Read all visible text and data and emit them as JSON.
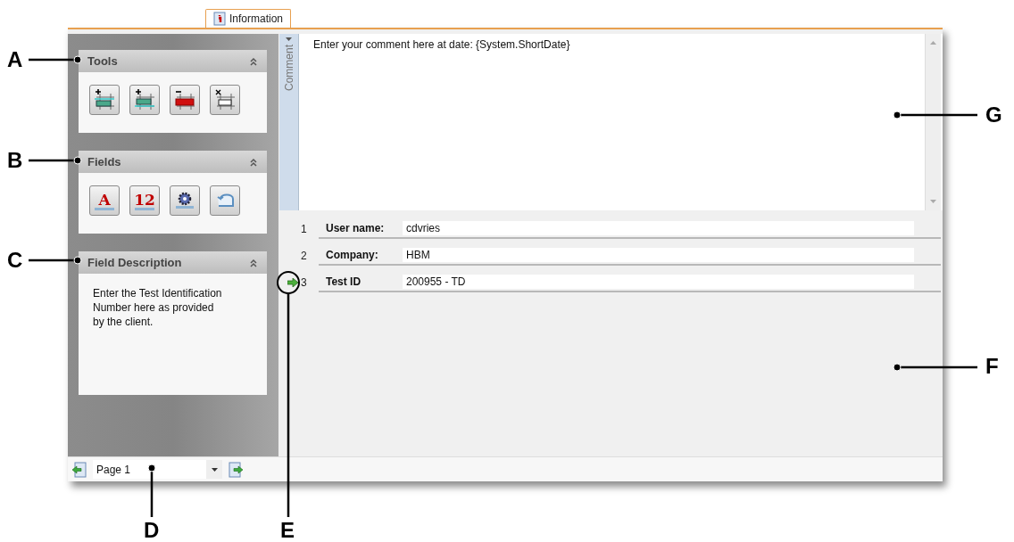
{
  "tab": {
    "label": "Information",
    "selected": true
  },
  "panels": [
    {
      "kind": "tools",
      "title": "Tools",
      "expanded": true,
      "buttons": [
        {
          "kind": "insert-above"
        },
        {
          "kind": "insert-below"
        },
        {
          "kind": "delete"
        },
        {
          "kind": "clear"
        }
      ]
    },
    {
      "kind": "fields",
      "title": "Fields",
      "expanded": true,
      "buttons": [
        {
          "kind": "text",
          "glyph": "A"
        },
        {
          "kind": "number",
          "glyph": "12"
        },
        {
          "kind": "settings"
        },
        {
          "kind": "undo"
        }
      ]
    },
    {
      "kind": "description",
      "title": "Field Description",
      "expanded": true,
      "text": "Enter the Test Identification Number here as provided by the client."
    }
  ],
  "comment": {
    "tab_label": "Comment",
    "value": "Enter your comment here at date: {System.ShortDate}"
  },
  "rows": [
    {
      "number": "1",
      "label": "User name:",
      "value": "cdvries",
      "selected": false
    },
    {
      "number": "2",
      "label": "Company:",
      "value": "HBM",
      "selected": false
    },
    {
      "number": "3",
      "label": "Test ID",
      "value": "200955 - TD",
      "selected": true
    }
  ],
  "page_selector": {
    "value": "Page 1"
  },
  "callouts": [
    "A",
    "B",
    "C",
    "D",
    "E",
    "F",
    "G"
  ]
}
